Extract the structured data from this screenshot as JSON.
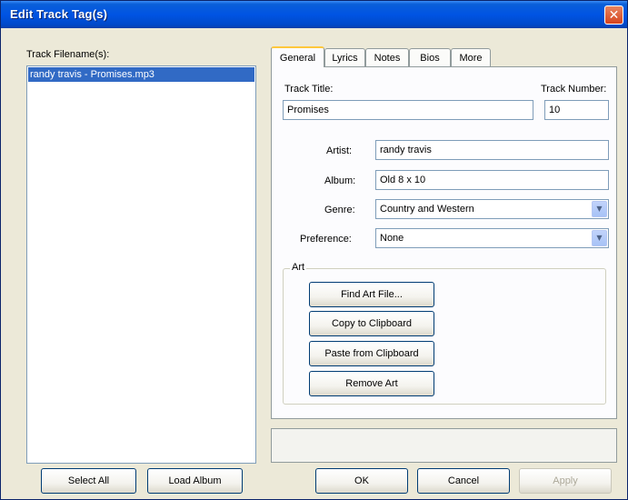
{
  "window": {
    "title": "Edit Track Tag(s)"
  },
  "left": {
    "filenames_label": "Track Filename(s):",
    "files": [
      "randy travis - Promises.mp3"
    ],
    "select_all": "Select All",
    "load_album": "Load Album"
  },
  "tabs": [
    "General",
    "Lyrics",
    "Notes",
    "Bios",
    "More"
  ],
  "general": {
    "track_title_label": "Track Title:",
    "track_title_value": "Promises",
    "track_number_label": "Track Number:",
    "track_number_value": "10",
    "artist_label": "Artist:",
    "artist_value": "randy travis",
    "album_label": "Album:",
    "album_value": "Old 8 x 10",
    "genre_label": "Genre:",
    "genre_value": "Country and Western",
    "preference_label": "Preference:",
    "preference_value": "None"
  },
  "art": {
    "group_label": "Art",
    "find_file": "Find Art File...",
    "copy": "Copy to Clipboard",
    "paste": "Paste from Clipboard",
    "remove": "Remove Art"
  },
  "footer": {
    "ok": "OK",
    "cancel": "Cancel",
    "apply": "Apply"
  },
  "icons": {
    "close": "close-icon",
    "dropdown": "chevron-down-icon"
  },
  "colors": {
    "titlebar": "#0054e3",
    "selection": "#316ac5",
    "window_bg": "#ece9d8"
  }
}
